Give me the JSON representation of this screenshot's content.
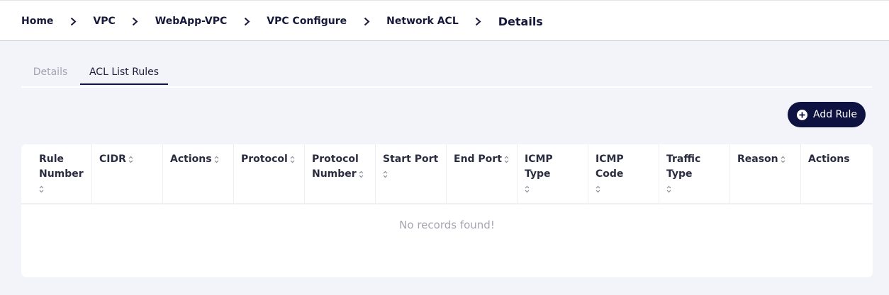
{
  "breadcrumb": {
    "items": [
      "Home",
      "VPC",
      "WebApp-VPC",
      "VPC Configure",
      "Network ACL"
    ],
    "current": "Details"
  },
  "tabs": [
    {
      "label": "Details",
      "active": false
    },
    {
      "label": "ACL List Rules",
      "active": true
    }
  ],
  "toolbar": {
    "add_rule_label": "Add Rule"
  },
  "table": {
    "columns": [
      {
        "line1": "Rule",
        "line2": "Number",
        "sortable": true
      },
      {
        "line1": "CIDR",
        "line2": "",
        "sortable": true
      },
      {
        "line1": "Actions",
        "line2": "",
        "sortable": true
      },
      {
        "line1": "Protocol",
        "line2": "",
        "sortable": true
      },
      {
        "line1": "Protocol",
        "line2": "Number",
        "sortable": true
      },
      {
        "line1": "Start Port",
        "line2": "",
        "sortable": true
      },
      {
        "line1": "End Port",
        "line2": "",
        "sortable": true
      },
      {
        "line1": "ICMP Type",
        "line2": "",
        "sortable": true
      },
      {
        "line1": "ICMP Code",
        "line2": "",
        "sortable": true
      },
      {
        "line1": "Traffic Type",
        "line2": "",
        "sortable": true
      },
      {
        "line1": "Reason",
        "line2": "",
        "sortable": true
      },
      {
        "line1": "Actions",
        "line2": "",
        "sortable": false
      }
    ],
    "rows": [],
    "empty_message": "No records found!"
  },
  "colors": {
    "accent": "#0d1241",
    "background": "#f3f4fa"
  },
  "icons": {
    "breadcrumb_separator": "chevron-right-icon",
    "add_button": "plus-circle-icon",
    "sort": "sort-icon"
  }
}
